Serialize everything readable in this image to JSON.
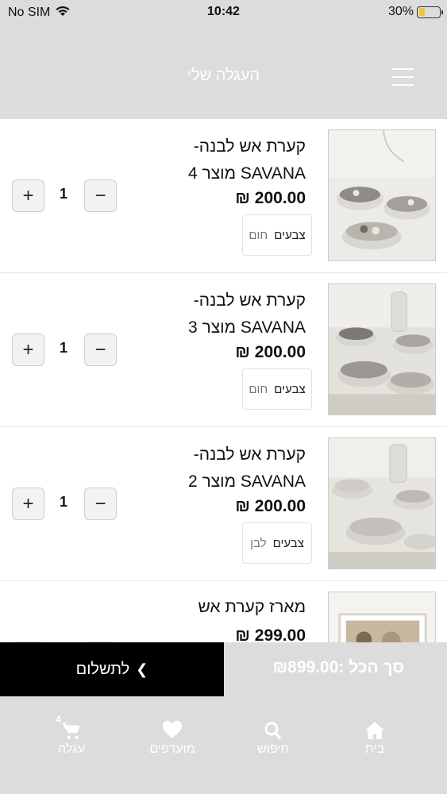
{
  "status_bar": {
    "carrier": "No SIM",
    "time": "10:42",
    "battery": "30%",
    "battery_level": 0.3
  },
  "header": {
    "title": "העגלה שלי"
  },
  "cart": {
    "items": [
      {
        "name_line1": "קערת אש לבנה-",
        "name_line2": "SAVANA מוצר 4",
        "price": "200.00 ₪",
        "option_label": "צבעים",
        "option_value": "חום",
        "quantity": "1"
      },
      {
        "name_line1": "קערת אש לבנה-",
        "name_line2": "SAVANA מוצר 3",
        "price": "200.00 ₪",
        "option_label": "צבעים",
        "option_value": "חום",
        "quantity": "1"
      },
      {
        "name_line1": "קערת אש לבנה-",
        "name_line2": "SAVANA מוצר 2",
        "price": "200.00 ₪",
        "option_label": "צבעים",
        "option_value": "לבן",
        "quantity": "1"
      },
      {
        "name_line1": "מארז קערת אש",
        "price": "299.00 ₪"
      }
    ],
    "plus_symbol": "+",
    "minus_symbol": "−"
  },
  "total_bar": {
    "total_text": "סך הכל :₪899.00",
    "checkout_label": "לתשלום"
  },
  "tab_bar": {
    "home": "בית",
    "search": "חיפוש",
    "favorites": "מועדפים",
    "cart": "עגלה",
    "cart_badge": "4"
  },
  "colors": {
    "header_bg": "#dcdcdc",
    "checkout_bg": "#000000",
    "text": "#111111"
  }
}
